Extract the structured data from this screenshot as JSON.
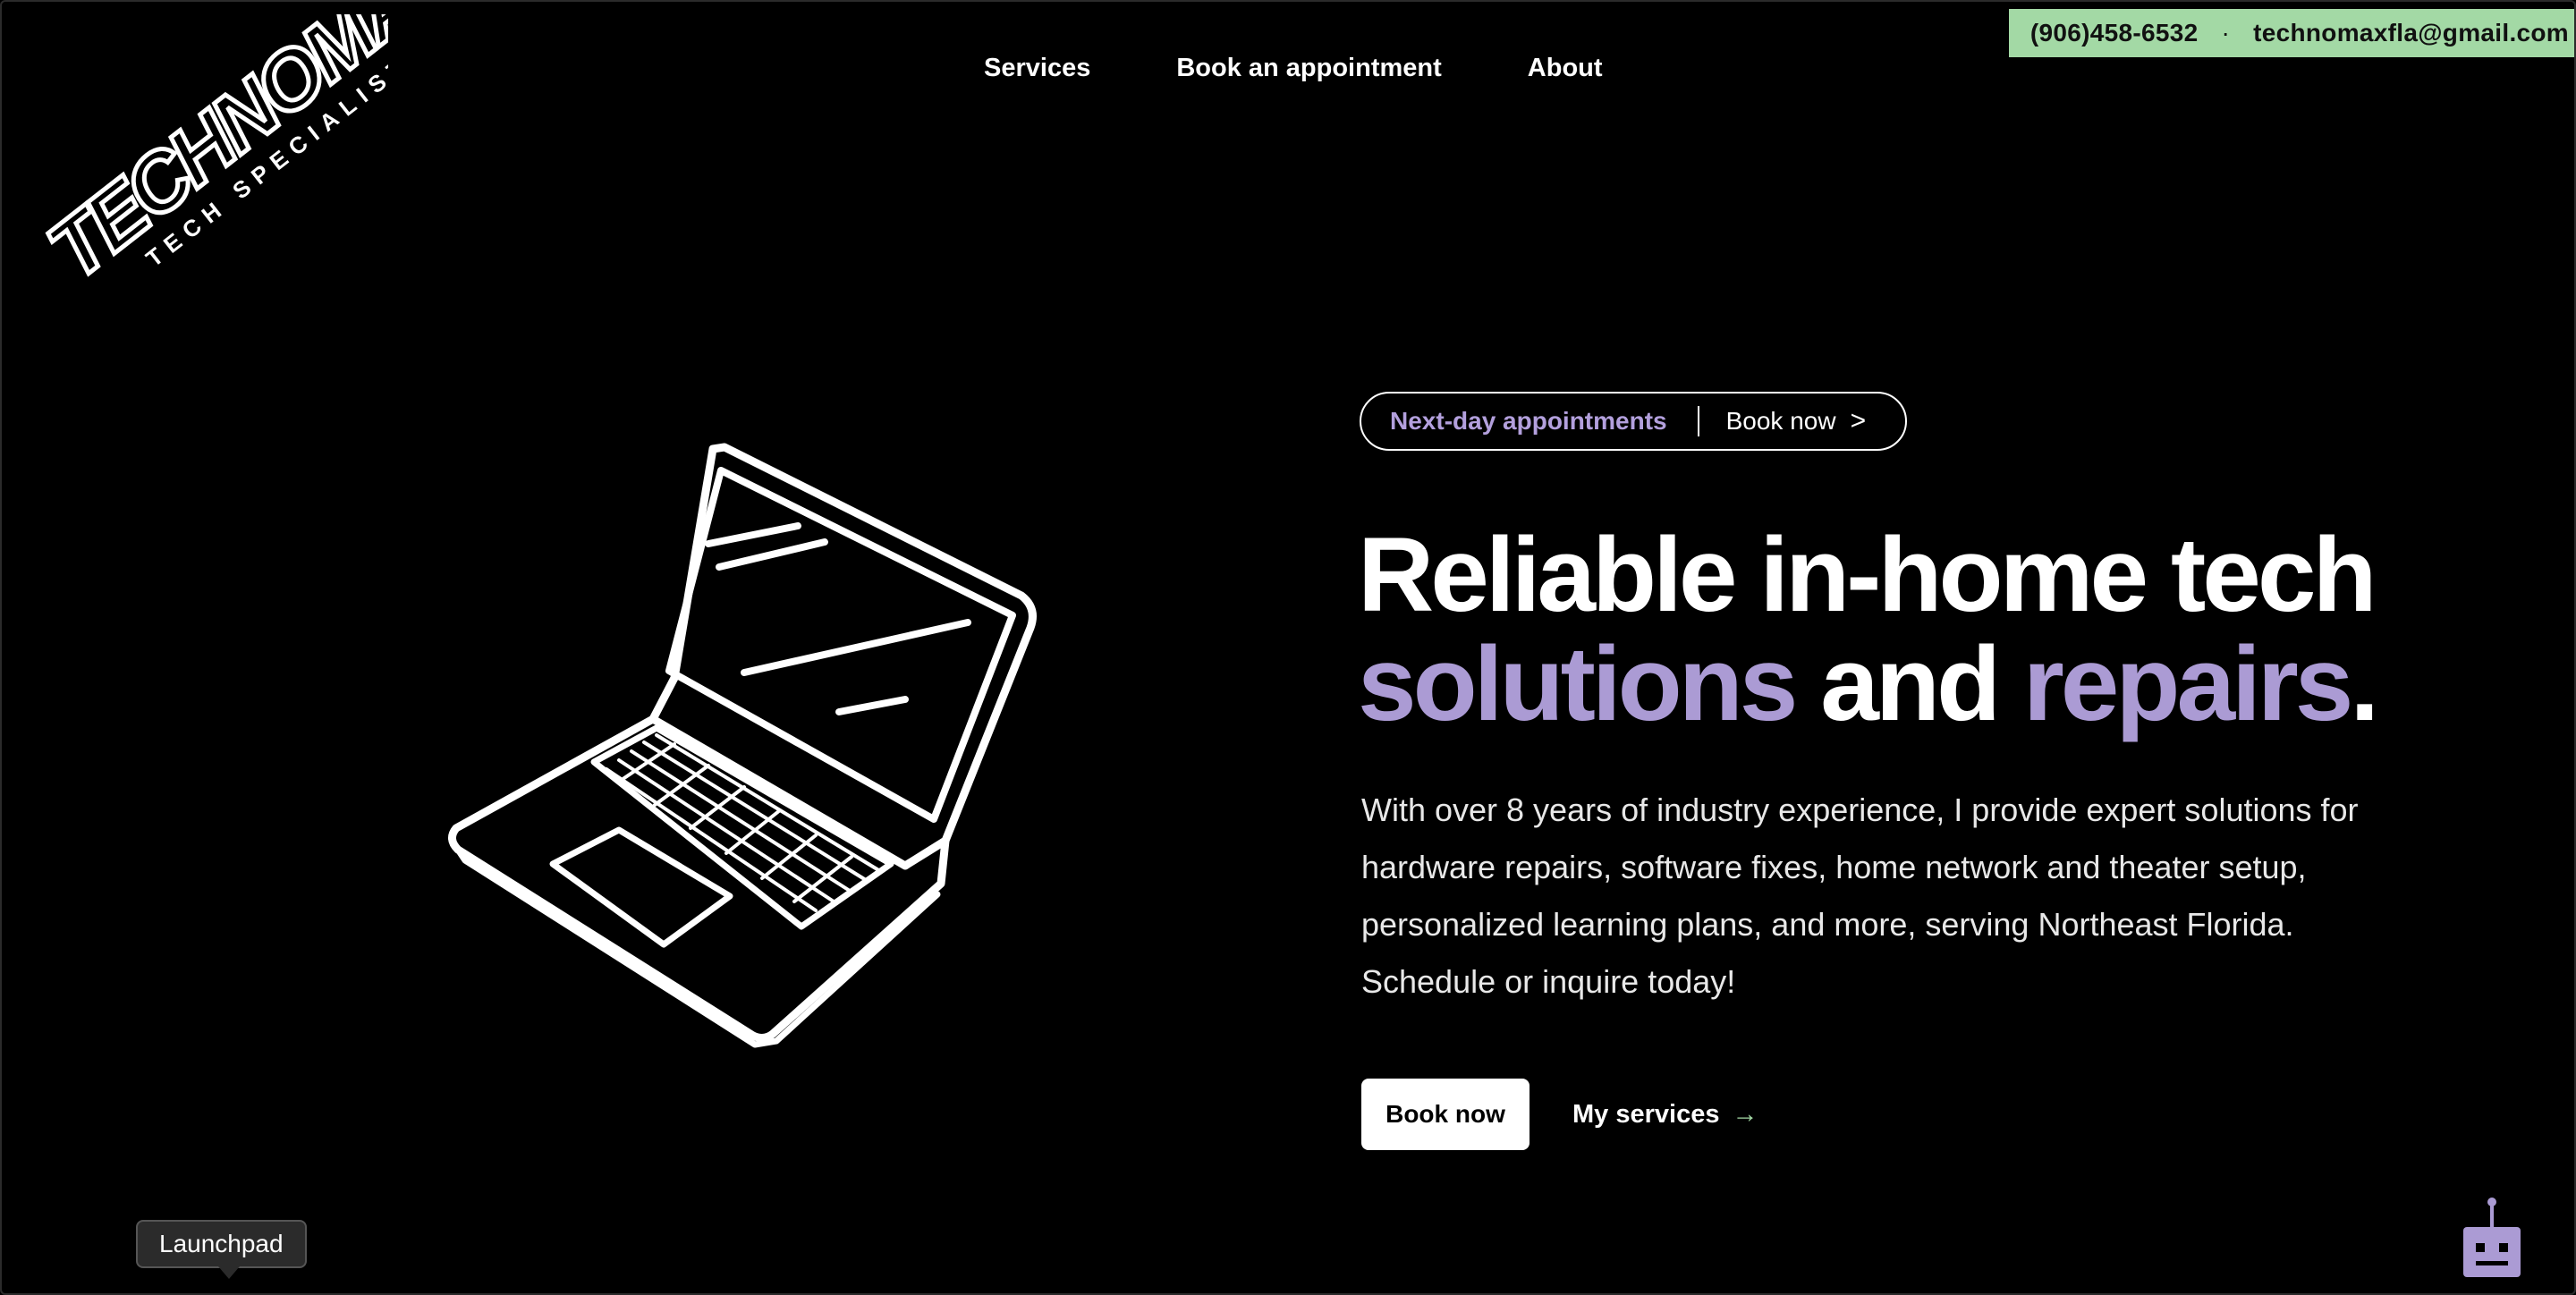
{
  "contact": {
    "phone": "(906)458-6532",
    "separator": "·",
    "email": "technomaxfla@gmail.com"
  },
  "logo": {
    "brand": "TECHNOMAX!!",
    "tagline": "TECH SPECIALIST"
  },
  "nav": {
    "items": [
      {
        "label": "Services"
      },
      {
        "label": "Book an appointment"
      },
      {
        "label": "About"
      }
    ]
  },
  "hero": {
    "pill_highlight": "Next-day appointments",
    "pill_action": "Book now",
    "pill_chevron": ">",
    "headline_line1": "Reliable in-home tech",
    "headline_word1": "solutions",
    "headline_mid": "and",
    "headline_word2": "repairs",
    "headline_end": ".",
    "description": "With over 8 years of industry experience, I provide expert solutions for hardware repairs, software fixes, home network and theater setup, personalized learning plans, and more, serving Northeast Florida. Schedule or inquire today!",
    "primary_button": "Book now",
    "secondary_link": "My services",
    "secondary_arrow": "→"
  },
  "tooltip": {
    "label": "Launchpad"
  },
  "icons": {
    "laptop": "laptop-illustration",
    "chatbot": "robot-icon"
  },
  "colors": {
    "background": "#000000",
    "accent_purple": "#ab9bd4",
    "contact_bar_green": "#a3d9a5",
    "text": "#ffffff"
  }
}
